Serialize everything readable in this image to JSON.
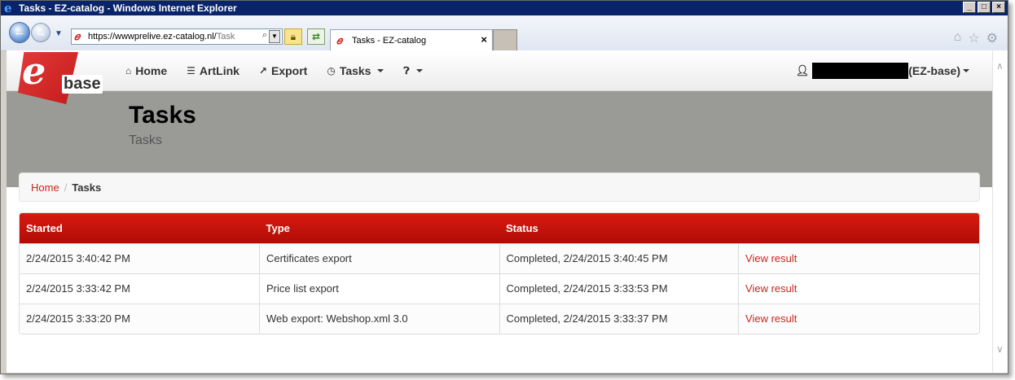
{
  "window": {
    "title": "Tasks - EZ-catalog - Windows Internet Explorer",
    "controls": [
      "_",
      "□",
      "×"
    ]
  },
  "browser": {
    "url_main": "https://wwwprelive.ez-catalog.nl/",
    "url_rest": "Task",
    "tab_title": "Tasks - EZ-catalog",
    "tab_close": "×",
    "icons": {
      "back": "back-arrow-icon",
      "forward": "forward-arrow-icon",
      "lock": "lock-icon",
      "refresh": "refresh-icon",
      "home": "home-icon",
      "favorites": "star-icon",
      "tools": "gear-icon"
    }
  },
  "brand": {
    "mark": "e",
    "name": "base"
  },
  "nav": {
    "home": "Home",
    "artlink": "ArtLink",
    "export": "Export",
    "tasks": "Tasks",
    "user_suffix": "(EZ-base)"
  },
  "page": {
    "title": "Tasks",
    "subtitle": "Tasks"
  },
  "breadcrumb": {
    "home": "Home",
    "separator": "/",
    "current": "Tasks"
  },
  "table": {
    "headers": [
      "Started",
      "Type",
      "Status",
      ""
    ],
    "rows": [
      {
        "started": "2/24/2015 3:40:42 PM",
        "type": "Certificates export",
        "status": "Completed, 2/24/2015 3:40:45 PM",
        "action": "View result"
      },
      {
        "started": "2/24/2015 3:33:42 PM",
        "type": "Price list export",
        "status": "Completed, 2/24/2015 3:33:53 PM",
        "action": "View result"
      },
      {
        "started": "2/24/2015 3:33:20 PM",
        "type": "Web export: Webshop.xml 3.0",
        "status": "Completed, 2/24/2015 3:33:37 PM",
        "action": "View result"
      }
    ]
  },
  "colors": {
    "accent": "#c8261c",
    "header_red": "#d81a10",
    "band_gray": "#9a9a97",
    "titlebar": "#0a246a"
  }
}
